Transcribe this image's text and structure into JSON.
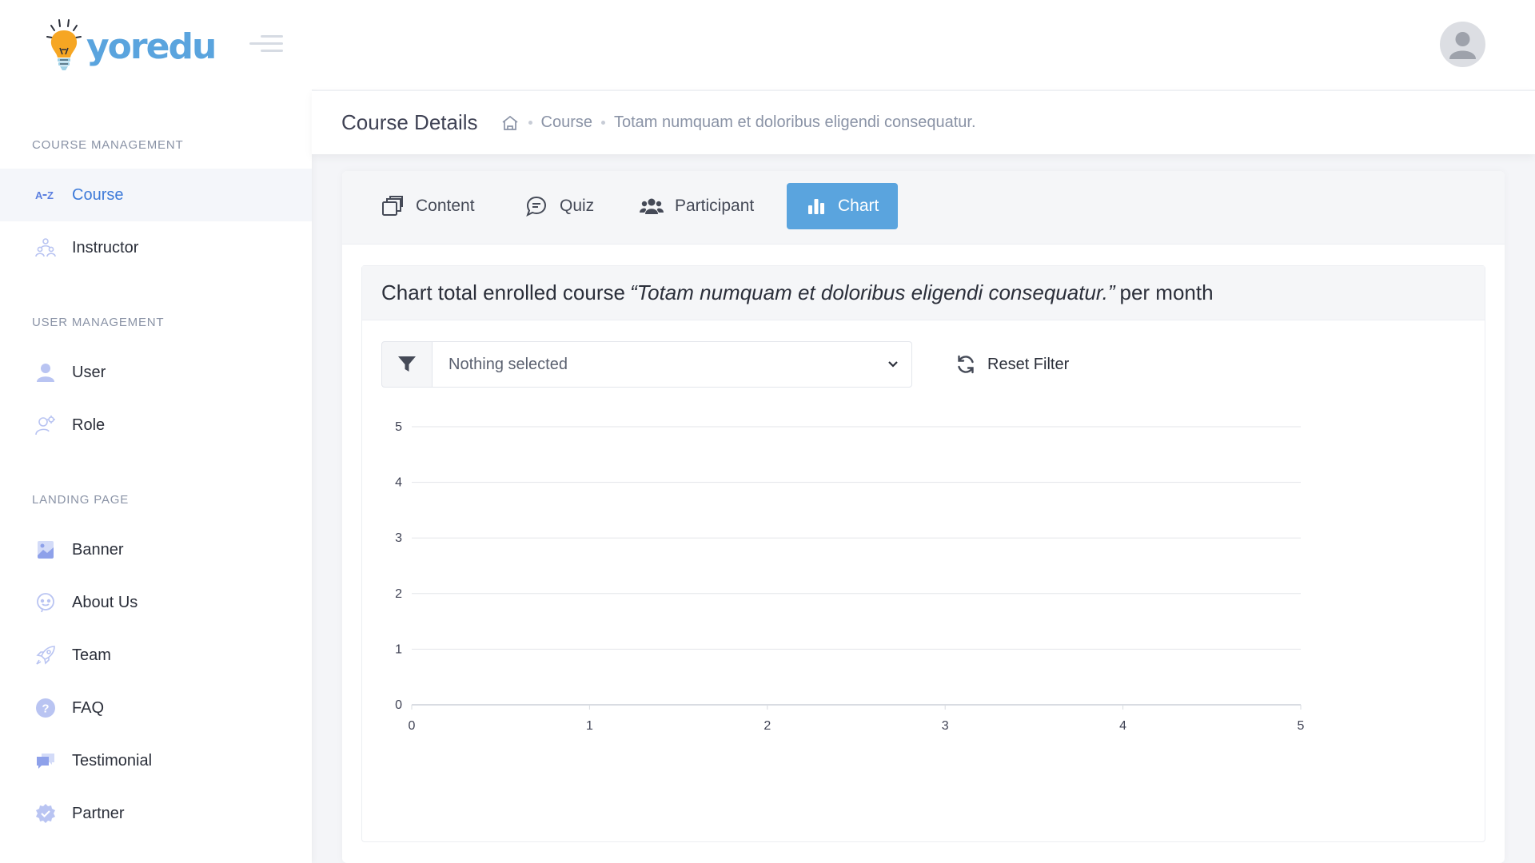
{
  "brand": {
    "name": "yoredu"
  },
  "sidebar": {
    "sections": [
      {
        "title": "COURSE MANAGEMENT",
        "items": [
          {
            "label": "Course",
            "icon": "az-sort-icon",
            "active": true
          },
          {
            "label": "Instructor",
            "icon": "people-group-icon"
          }
        ]
      },
      {
        "title": "USER MANAGEMENT",
        "items": [
          {
            "label": "User",
            "icon": "user-icon"
          },
          {
            "label": "Role",
            "icon": "user-gear-icon"
          }
        ]
      },
      {
        "title": "LANDING PAGE",
        "items": [
          {
            "label": "Banner",
            "icon": "image-icon"
          },
          {
            "label": "About Us",
            "icon": "chat-bubble-icon"
          },
          {
            "label": "Team",
            "icon": "rocket-icon"
          },
          {
            "label": "FAQ",
            "icon": "question-circle-icon"
          },
          {
            "label": "Testimonial",
            "icon": "comments-icon"
          },
          {
            "label": "Partner",
            "icon": "badge-check-icon"
          }
        ]
      }
    ]
  },
  "header": {
    "page_title": "Course Details",
    "breadcrumb": [
      "Course",
      "Totam numquam et doloribus eligendi consequatur."
    ]
  },
  "tabs": [
    {
      "label": "Content",
      "icon": "copy-icon"
    },
    {
      "label": "Quiz",
      "icon": "chat-quote-icon"
    },
    {
      "label": "Participant",
      "icon": "users-icon"
    },
    {
      "label": "Chart",
      "icon": "bar-chart-icon",
      "active": true
    }
  ],
  "chart_panel": {
    "title_prefix": "Chart total enrolled course",
    "title_course": "“Totam numquam et doloribus eligendi consequatur.”",
    "title_suffix": "per month",
    "filter_placeholder": "Nothing selected",
    "reset_label": "Reset Filter"
  },
  "colors": {
    "accent": "#5aa4de",
    "active_text": "#3e7bd9",
    "icon_muted": "#b9c4f2"
  },
  "chart_data": {
    "type": "line",
    "title": "",
    "xlabel": "",
    "ylabel": "",
    "x_ticks": [
      0,
      1,
      2,
      3,
      4,
      5
    ],
    "y_ticks": [
      0,
      1,
      2,
      3,
      4,
      5
    ],
    "xlim": [
      0,
      5
    ],
    "ylim": [
      0,
      5
    ],
    "series": [],
    "grid": true,
    "legend": "none"
  }
}
